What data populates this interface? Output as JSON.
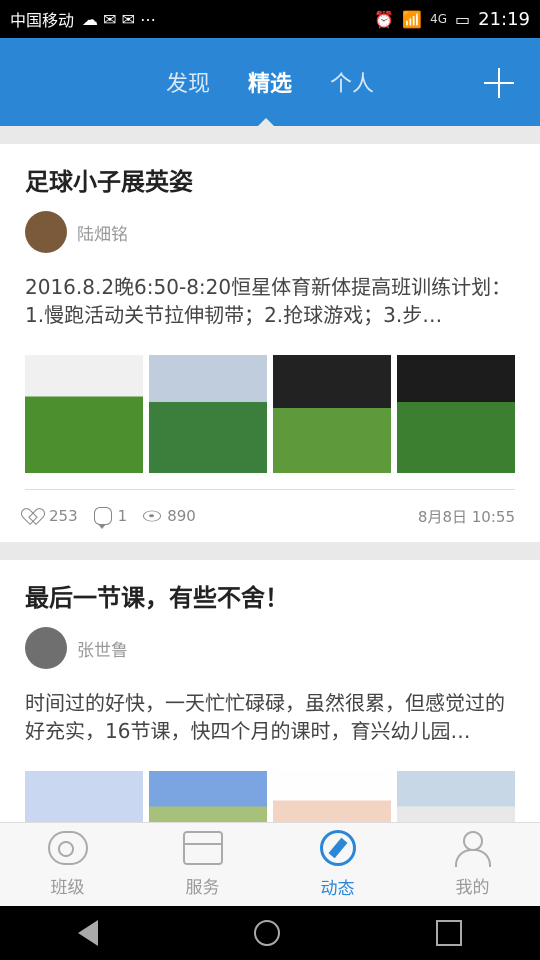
{
  "status_bar": {
    "carrier": "中国移动",
    "network": "4G",
    "time": "21:19"
  },
  "header": {
    "tabs": [
      {
        "label": "发现",
        "active": false
      },
      {
        "label": "精选",
        "active": true
      },
      {
        "label": "个人",
        "active": false
      }
    ],
    "add_icon": "plus-icon"
  },
  "posts": [
    {
      "title": "足球小子展英姿",
      "author": "陆畑铭",
      "content": "  2016.8.2晚6:50-8:20恒星体育新体提高班训练计划：1.慢跑活动关节拉伸韧带；2.抢球游戏；3.步…",
      "likes": "253",
      "comments": "1",
      "views": "890",
      "date": "8月8日 10:55"
    },
    {
      "title": "最后一节课，有些不舍！",
      "author": "张世鲁",
      "content": "时间过的好快，一天忙忙碌碌，虽然很累，但感觉过的好充实，16节课，快四个月的课时，育兴幼儿园…"
    }
  ],
  "bottom_nav": [
    {
      "label": "班级",
      "icon": "whistle-icon",
      "active": false
    },
    {
      "label": "服务",
      "icon": "shop-icon",
      "active": false
    },
    {
      "label": "动态",
      "icon": "compass-icon",
      "active": true
    },
    {
      "label": "我的",
      "icon": "person-icon",
      "active": false
    }
  ],
  "colors": {
    "accent": "#2b86d6",
    "background": "#e9e9e9"
  }
}
